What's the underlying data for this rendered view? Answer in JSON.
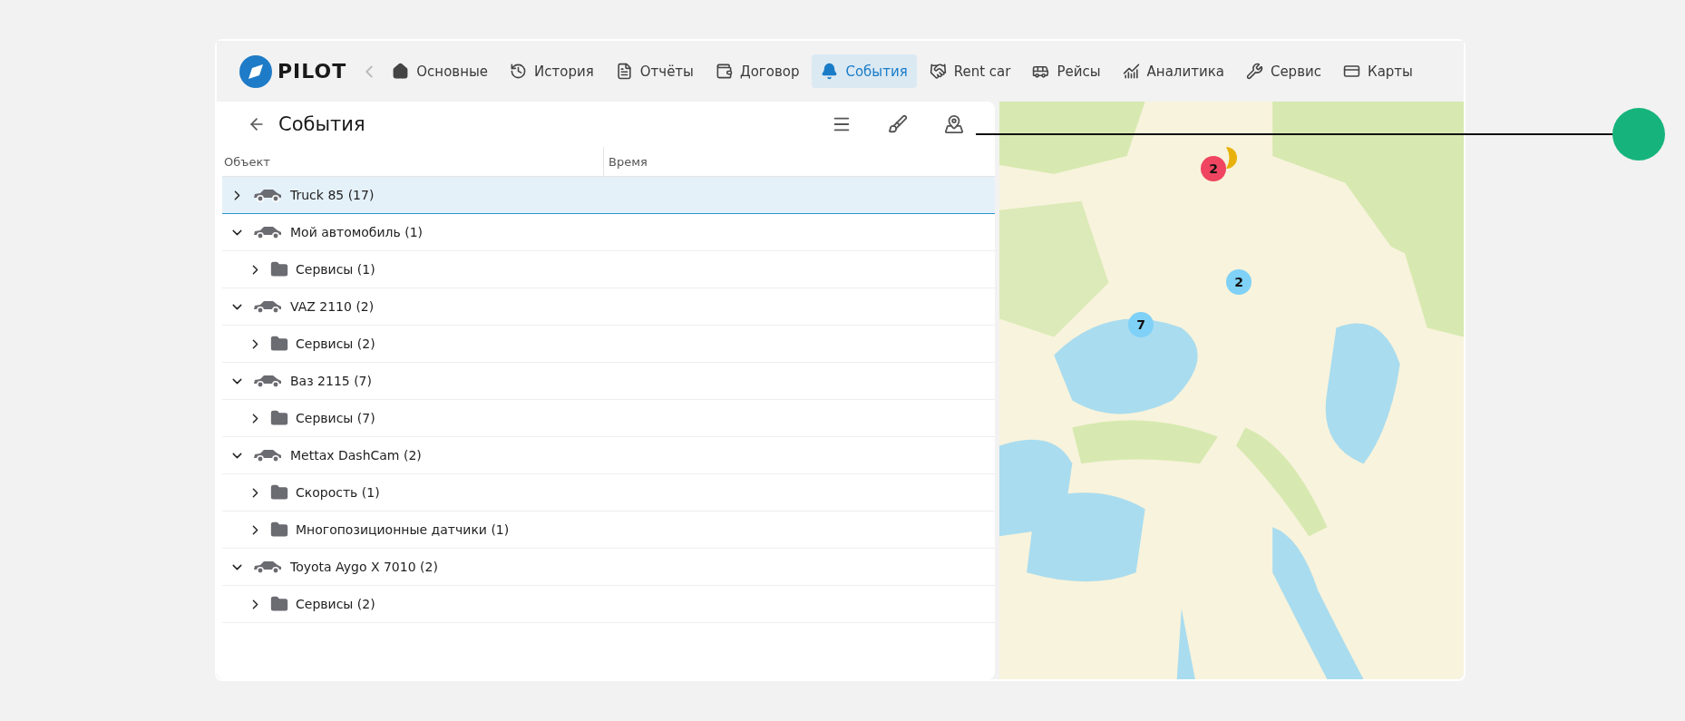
{
  "logo": {
    "text": "PILOT"
  },
  "nav": [
    {
      "label": "Основные",
      "selected": false
    },
    {
      "label": "История",
      "selected": false
    },
    {
      "label": "Отчёты",
      "selected": false
    },
    {
      "label": "Договор",
      "selected": false
    },
    {
      "label": "События",
      "selected": true
    },
    {
      "label": "Rent car",
      "selected": false
    },
    {
      "label": "Рейсы",
      "selected": false
    },
    {
      "label": "Аналитика",
      "selected": false
    },
    {
      "label": "Сервис",
      "selected": false
    },
    {
      "label": "Карты",
      "selected": false
    }
  ],
  "panel": {
    "title": "События",
    "columns": [
      "Объект",
      "Время"
    ]
  },
  "tree": [
    {
      "kind": "vehicle",
      "label": "Truck 85 (17)",
      "expanded": false,
      "selected": true
    },
    {
      "kind": "vehicle",
      "label": "Мой автомобиль (1)",
      "expanded": true,
      "selected": false,
      "children": [
        {
          "kind": "folder",
          "label": "Сервисы (1)",
          "expanded": false,
          "selected": false
        }
      ]
    },
    {
      "kind": "vehicle",
      "label": "VAZ 2110 (2)",
      "expanded": true,
      "selected": false,
      "children": [
        {
          "kind": "folder",
          "label": "Сервисы (2)",
          "expanded": false,
          "selected": false
        }
      ]
    },
    {
      "kind": "vehicle",
      "label": "Ваз 2115 (7)",
      "expanded": true,
      "selected": false,
      "children": [
        {
          "kind": "folder",
          "label": "Сервисы (7)",
          "expanded": false,
          "selected": false
        }
      ]
    },
    {
      "kind": "vehicle",
      "label": "Mettax DashCam (2)",
      "expanded": true,
      "selected": false,
      "children": [
        {
          "kind": "folder",
          "label": "Скорость (1)",
          "expanded": false,
          "selected": false
        },
        {
          "kind": "folder",
          "label": "Многопозиционные датчики (1)",
          "expanded": false,
          "selected": false
        }
      ]
    },
    {
      "kind": "vehicle",
      "label": "Toyota Aygo X 7010 (2)",
      "expanded": true,
      "selected": false,
      "children": [
        {
          "kind": "folder",
          "label": "Сервисы (2)",
          "expanded": false,
          "selected": false
        }
      ]
    }
  ],
  "map": {
    "kind": "picture",
    "markers": [
      {
        "kind": "partial",
        "color": "#e8b10c"
      },
      {
        "kind": "cluster",
        "count": "2",
        "color": "#ef4560"
      },
      {
        "kind": "cluster",
        "count": "2",
        "color": "#7fd1f7"
      },
      {
        "kind": "cluster",
        "count": "7",
        "color": "#7fd1f7"
      }
    ]
  }
}
